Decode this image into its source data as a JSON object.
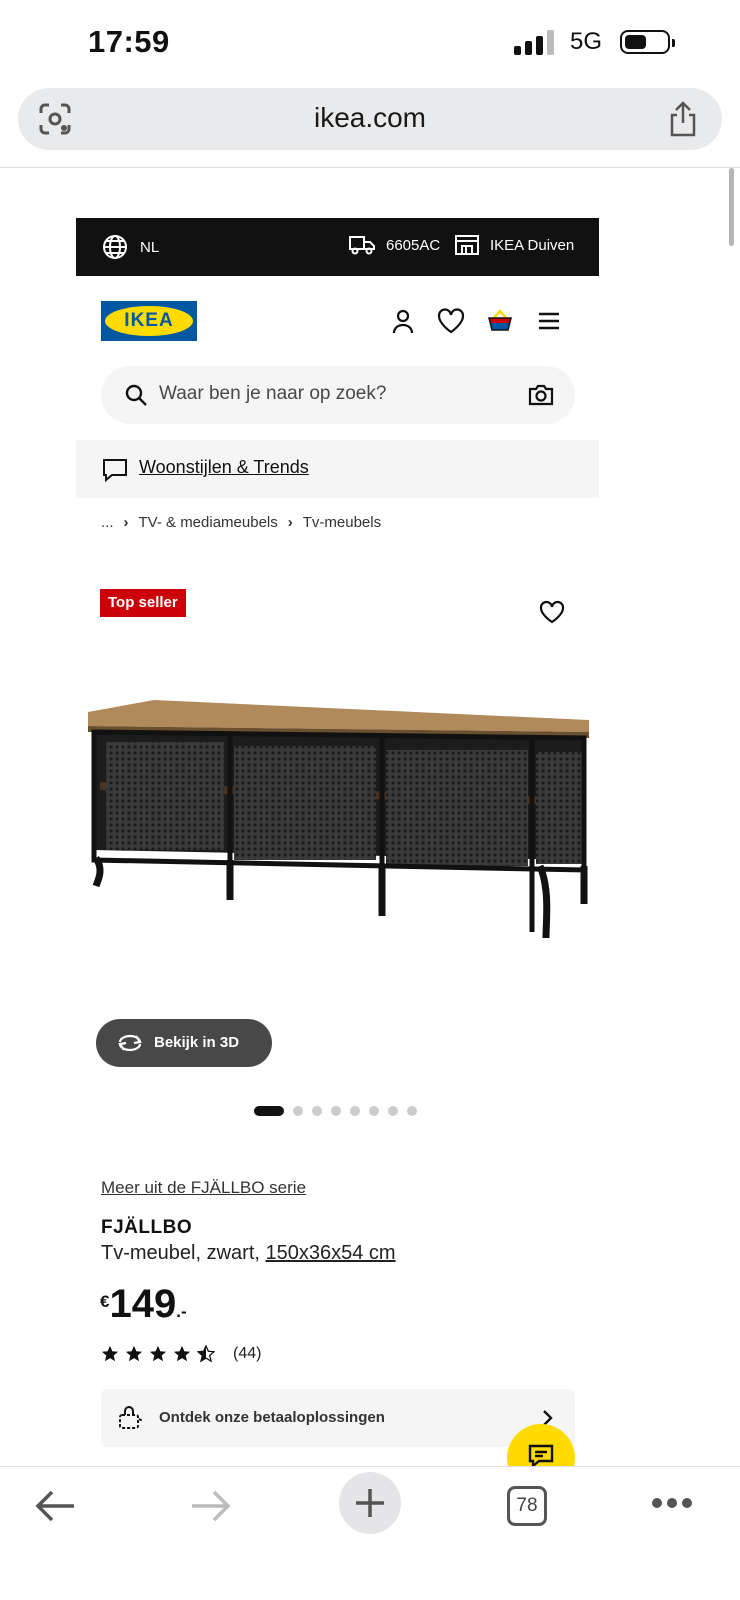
{
  "status": {
    "time": "17:59",
    "network": "5G"
  },
  "browser": {
    "url": "ikea.com",
    "tab_count": "78"
  },
  "top_bar": {
    "language": "NL",
    "postal_code": "6605AC",
    "store": "IKEA Duiven"
  },
  "header": {
    "logo_text": "IKEA"
  },
  "search": {
    "placeholder": "Waar ben je naar op zoek?"
  },
  "styles_banner": {
    "label": "Woonstijlen & Trends"
  },
  "breadcrumb": {
    "ellipsis": "...",
    "items": [
      "TV- & mediameubels",
      "Tv-meubels"
    ]
  },
  "product": {
    "badge": "Top seller",
    "view_3d_label": "Bekijk in 3D",
    "image_count": 8,
    "active_image": 1,
    "series_link": "Meer uit de FJÄLLBO serie",
    "name": "FJÄLLBO",
    "description": "Tv-meubel, zwart, ",
    "dimensions": "150x36x54 cm",
    "price_currency": "€",
    "price_amount": "149",
    "price_suffix": ".-",
    "rating": 4.5,
    "review_count": "(44)"
  },
  "payment_banner": {
    "label": "Ontdek onze betaaloplossingen"
  },
  "colors": {
    "ikea_blue": "#0058a3",
    "ikea_yellow": "#ffdb00",
    "badge_red": "#cc0008"
  }
}
